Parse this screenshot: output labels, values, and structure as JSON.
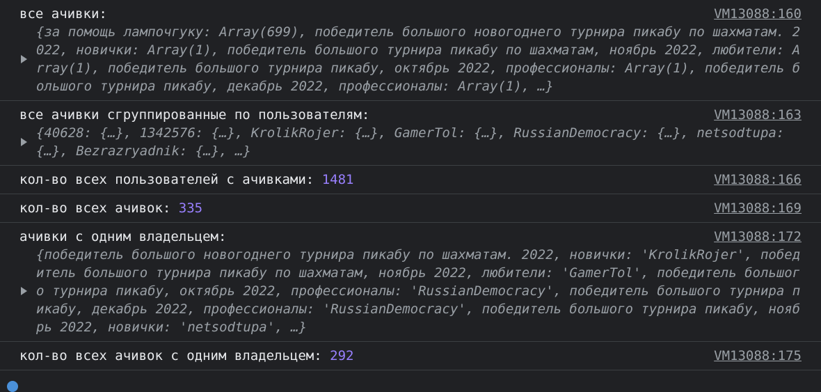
{
  "logs": [
    {
      "label": "все ачивки:",
      "source": "VM13088:160",
      "preview": "{за помощь лампочгуку: Array(699), победитель большого новогоднего турнира пикабу по шахматам. 2022, новички: Array(1), победитель большого турнира пикабу по шахматам, ноябрь 2022, любители: Array(1), победитель большого турнира пикабу, октябрь 2022, профессионалы: Array(1), победитель большого турнира пикабу, декабрь 2022, профессионалы: Array(1), …}"
    },
    {
      "label": "все ачивки сгруппированные по пользователям:",
      "source": "VM13088:163",
      "preview": "{40628: {…}, 1342576: {…}, KrolikRojer: {…}, GamerTol: {…}, RussianDemocracy: {…}, netsodtupa: {…}, Bezrazryadnik: {…}, …}"
    },
    {
      "label": "кол-во всех пользователей с ачивками: ",
      "value": "1481",
      "source": "VM13088:166"
    },
    {
      "label": "кол-во всех ачивок: ",
      "value": "335",
      "source": "VM13088:169"
    },
    {
      "label": "ачивки с одним владельцем:",
      "source": "VM13088:172",
      "preview": "{победитель большого новогоднего турнира пикабу по шахматам. 2022, новички: 'KrolikRojer', победитель большого турнира пикабу по шахматам, ноябрь 2022, любители: 'GamerTol', победитель большого турнира пикабу, октябрь 2022, профессионалы: 'RussianDemocracy', победитель большого турнира пикабу, декабрь 2022, профессионалы: 'RussianDemocracy', победитель большого турнира пикабу, ноябрь 2022, новички: 'netsodtupa', …}"
    },
    {
      "label": "кол-во всех ачивок с одним владельцем: ",
      "value": "292",
      "source": "VM13088:175"
    }
  ]
}
